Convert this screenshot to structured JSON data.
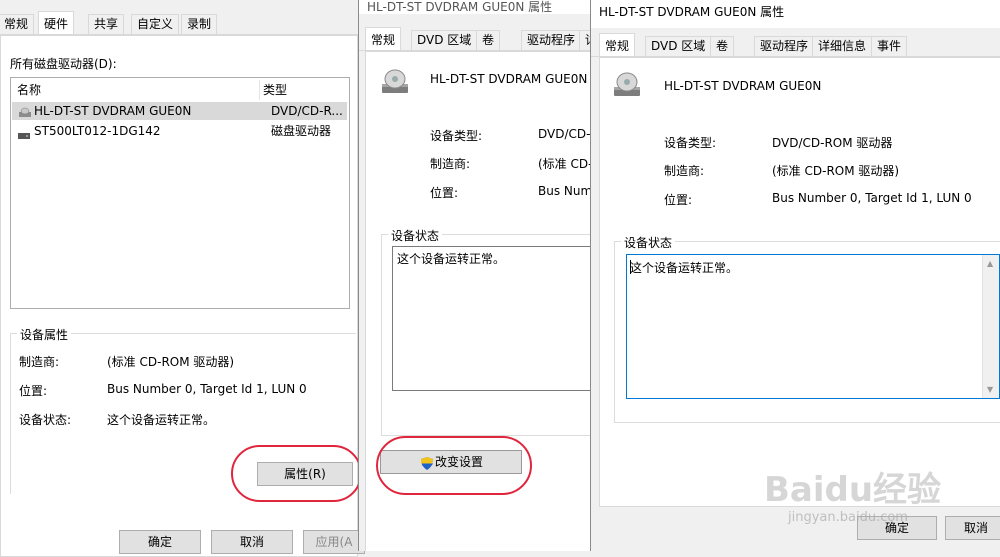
{
  "win1": {
    "tabs": [
      "常规",
      "硬件",
      "共享",
      "自定义",
      "录制"
    ],
    "selected_tab": "硬件",
    "list_label": "所有磁盘驱动器(D):",
    "columns": [
      "名称",
      "类型"
    ],
    "rows": [
      {
        "name": "HL-DT-ST DVDRAM GUE0N",
        "type": "DVD/CD-R..."
      },
      {
        "name": "ST500LT012-1DG142",
        "type": "磁盘驱动器"
      }
    ],
    "props_group": "设备属性",
    "props": [
      {
        "label": "制造商:",
        "value": "(标准 CD-ROM 驱动器)"
      },
      {
        "label": "位置:",
        "value": "Bus Number 0, Target Id 1, LUN 0"
      },
      {
        "label": "设备状态:",
        "value": "这个设备运转正常。"
      }
    ],
    "properties_button": "属性(R)",
    "ok": "确定",
    "cancel": "取消",
    "apply": "应用(A"
  },
  "win2": {
    "title": "HL-DT-ST DVDRAM GUE0N 属性",
    "tabs": [
      "常规",
      "DVD 区域",
      "卷",
      "驱动程序",
      "详"
    ],
    "device_name": "HL-DT-ST DVDRAM GUE0N",
    "props": [
      {
        "label": "设备类型:",
        "value": "DVD/CD-I"
      },
      {
        "label": "制造商:",
        "value": "(标准 CD-"
      },
      {
        "label": "位置:",
        "value": "Bus Num"
      }
    ],
    "status_group": "设备状态",
    "status_text": "这个设备运转正常。",
    "change_settings_button": "改变设置"
  },
  "win3": {
    "title": "HL-DT-ST DVDRAM GUE0N 属性",
    "tabs": [
      "常规",
      "DVD 区域",
      "卷",
      "驱动程序",
      "详细信息",
      "事件"
    ],
    "device_name": "HL-DT-ST DVDRAM GUE0N",
    "props": [
      {
        "label": "设备类型:",
        "value": "DVD/CD-ROM 驱动器"
      },
      {
        "label": "制造商:",
        "value": "(标准 CD-ROM 驱动器)"
      },
      {
        "label": "位置:",
        "value": "Bus Number 0, Target Id 1, LUN 0"
      }
    ],
    "status_group": "设备状态",
    "status_text": "这个设备运转正常。",
    "ok": "确定",
    "cancel": "取消"
  },
  "watermark": {
    "brand": "Baidu经验",
    "url": "jingyan.baidu.com"
  },
  "colors": {
    "highlight": "#e0263d",
    "selection": "#d9d9d9",
    "accent": "#0078d7"
  }
}
